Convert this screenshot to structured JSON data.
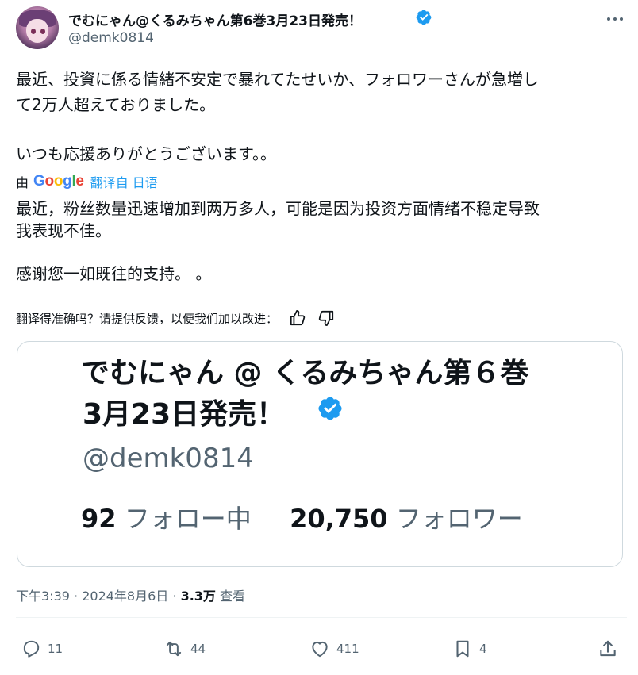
{
  "user": {
    "display_name": "でむにゃん@くるみちゃん第6巻3月23日発売！",
    "handle": "@demk0814",
    "avatar_icon": "avatar",
    "verified_icon": "verified-badge-icon"
  },
  "tweet": {
    "lines": [
      "最近、投資に係る情緒不安定で暴れてたせいか、フォロワーさんが急増し",
      "て2万人超えておりました。",
      "いつも応援ありがとうございます。。"
    ]
  },
  "translation": {
    "by": "由",
    "google": "Google",
    "link": "翻译自 日语",
    "lines": [
      "最近，粉丝数量迅速增加到两万多人，可能是因为投资方面情绪不稳定导致",
      "我表现不佳。",
      "感谢您一如既往的支持。 。"
    ],
    "feedback": "翻译得准确吗？请提供反馈，以便我们加以改进："
  },
  "card": {
    "name_line1": "でむにゃん @ くるみちゃん第６巻",
    "name_line2": "3月23日発売！",
    "handle": "@demk0814",
    "following_count": "92",
    "following_label": "フォロー中",
    "followers_count": "20,750",
    "followers_label": "フォロワー"
  },
  "meta": {
    "time": "下午3:39",
    "sep1": " · ",
    "date": "2024年8月6日",
    "sep2": " · ",
    "views": "3.3万",
    "views_label": " 查看"
  },
  "actions": {
    "replies": "11",
    "reposts": "44",
    "likes": "411",
    "bookmarks": "4"
  },
  "colors": {
    "accent": "#1d9bf0",
    "text": "#0f1419",
    "secondary": "#536471",
    "border": "#cfd9de"
  }
}
